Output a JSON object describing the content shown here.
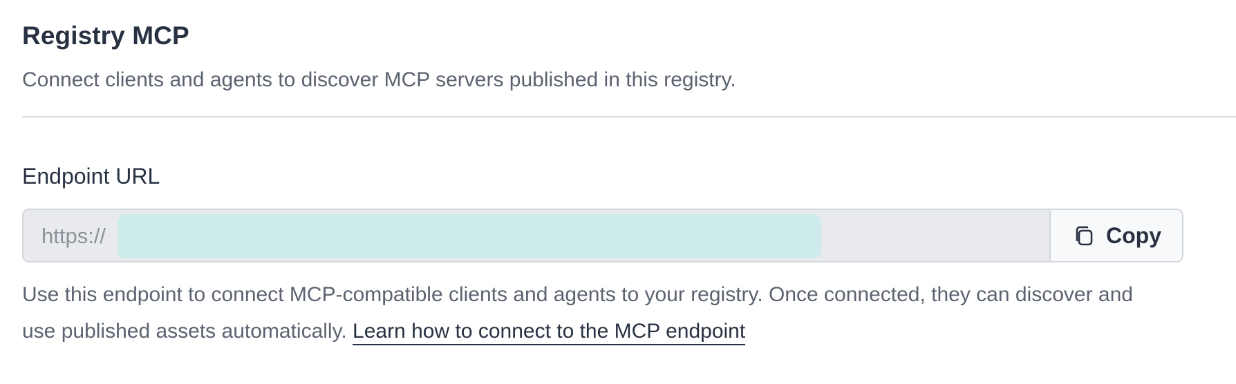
{
  "section": {
    "title": "Registry MCP",
    "description": "Connect clients and agents to discover MCP servers published in this registry."
  },
  "endpoint": {
    "label": "Endpoint URL",
    "url_prefix": "https://",
    "copy_label": "Copy",
    "copy_icon": "copy-icon",
    "help_text": "Use this endpoint to connect MCP-compatible clients and agents to your registry. Once connected, they can discover and use published assets automatically.",
    "help_link_label": "Learn how to connect to the MCP endpoint"
  },
  "colors": {
    "redaction": "#cdebea",
    "field_background": "#e9eaed",
    "text_primary": "#283142",
    "text_secondary": "#5b6270"
  }
}
